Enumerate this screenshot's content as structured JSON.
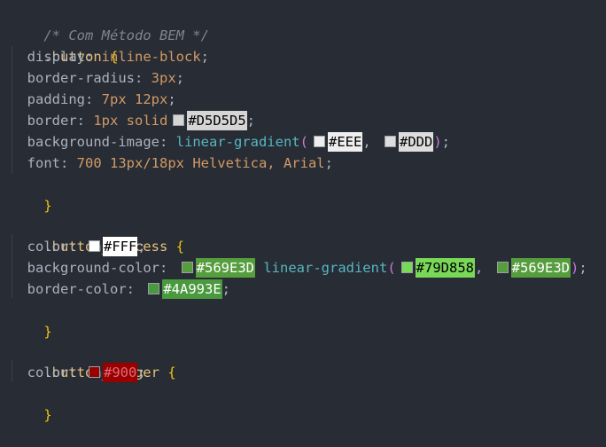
{
  "editor": {
    "comment": "/* Com Método BEM */",
    "button": {
      "selector": ".button",
      "display_prop": "display",
      "display_val": "inline-block",
      "radius_prop": "border-radius",
      "radius_val": "3px",
      "padding_prop": "padding",
      "padding_val": "7px 12px",
      "border_prop": "border",
      "border_val": "1px solid",
      "border_color": "#D5D5D5",
      "bgimg_prop": "background-image",
      "bgimg_fn": "linear-gradient",
      "grad_color_1": "#EEE",
      "grad_color_2": "#DDD",
      "font_prop": "font",
      "font_val": "700 13px/18px Helvetica, Arial"
    },
    "success": {
      "selector": ".button_success",
      "color_prop": "color",
      "color_val": "#FFF",
      "bgcolor_prop": "background-color",
      "bgcolor_val": "#569E3D",
      "grad_fn": "linear-gradient",
      "grad_color_1": "#79D858",
      "grad_color_2": "#569E3D",
      "bordercolor_prop": "border-color",
      "bordercolor_val": "#4A993E"
    },
    "danger": {
      "selector": ".button_danger",
      "color_prop": "color",
      "color_val": "#900"
    },
    "open_brace": "{",
    "close_brace": "}"
  },
  "colors": {
    "background": "#282c34",
    "selector": "#e5c07b",
    "brace": "#f1c40f",
    "number": "#d19a66",
    "function": "#56b6c2",
    "comment": "#7f848e"
  }
}
